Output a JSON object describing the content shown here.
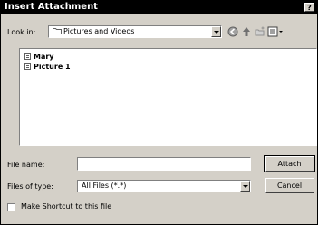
{
  "title": "Insert Attachment",
  "title_help": "?",
  "look_in": {
    "label": "Look in:",
    "value": "Pictures and Videos"
  },
  "files": [
    {
      "name": "Mary"
    },
    {
      "name": "Picture 1"
    }
  ],
  "file_name": {
    "label": "File name:",
    "value": ""
  },
  "file_type": {
    "label": "Files of type:",
    "value": "All Files (*.*)"
  },
  "buttons": {
    "attach": "Attach",
    "cancel": "Cancel"
  },
  "shortcut": {
    "label": "Make Shortcut to this file",
    "checked": false
  }
}
